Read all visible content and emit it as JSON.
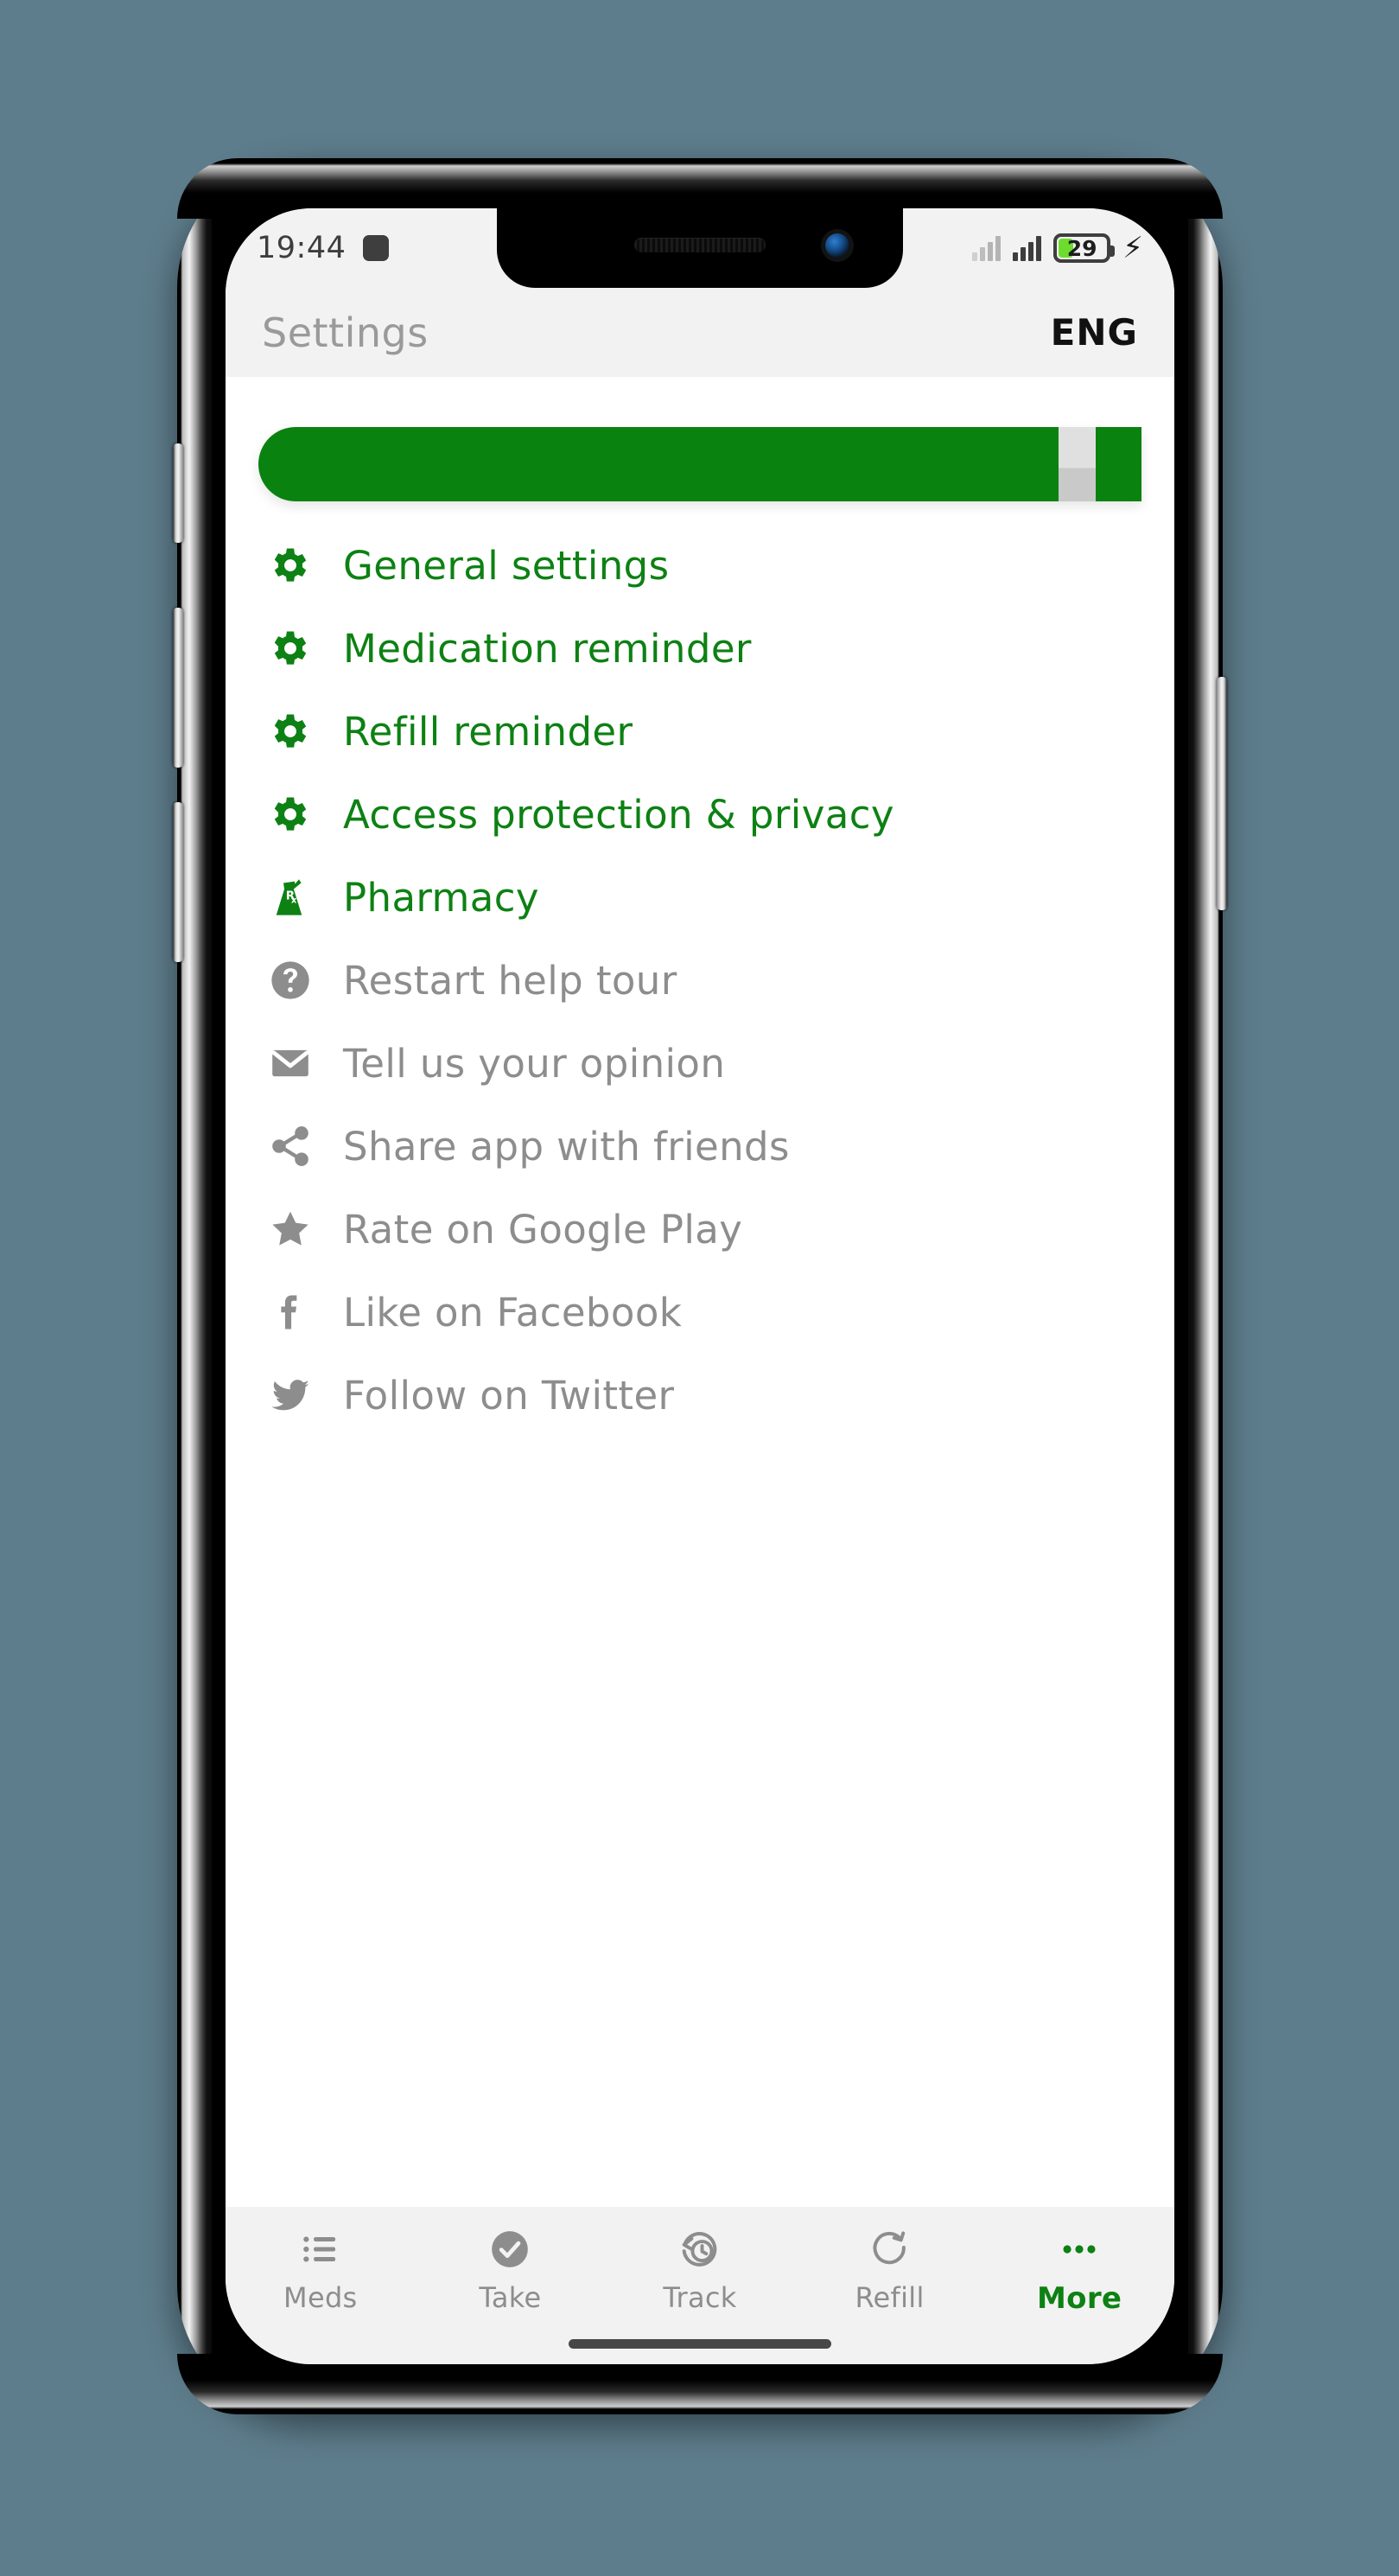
{
  "theme": {
    "background": "#5e7d8c",
    "accent_green": "#0d8113",
    "banner_green": "#0a8210",
    "muted_gray": "#8d8d8d",
    "header_bg": "#f2f2f2"
  },
  "status_bar": {
    "time": "19:44",
    "notification_icon": "square-notification-icon",
    "signal_icons": [
      "signal-bars-dim-icon",
      "signal-bars-icon"
    ],
    "battery_level": "29",
    "battery_percent": 29,
    "charging_icon": "charging-bolt-icon"
  },
  "header": {
    "title": "Settings",
    "language": "ENG"
  },
  "banner": {
    "name": "progress-banner",
    "color": "#0a8210"
  },
  "menu": {
    "items": [
      {
        "label": "General settings",
        "icon": "gear-icon",
        "style": "green"
      },
      {
        "label": "Medication reminder",
        "icon": "gear-icon",
        "style": "green"
      },
      {
        "label": "Refill reminder",
        "icon": "gear-icon",
        "style": "green"
      },
      {
        "label": "Access protection & privacy",
        "icon": "gear-icon",
        "style": "green"
      },
      {
        "label": "Pharmacy",
        "icon": "pharmacy-rx-icon",
        "style": "green"
      },
      {
        "label": "Restart help tour",
        "icon": "help-circle-icon",
        "style": "gray"
      },
      {
        "label": "Tell us your opinion",
        "icon": "envelope-icon",
        "style": "gray"
      },
      {
        "label": "Share app with friends",
        "icon": "share-icon",
        "style": "gray"
      },
      {
        "label": "Rate on Google Play",
        "icon": "star-icon",
        "style": "gray"
      },
      {
        "label": "Like on Facebook",
        "icon": "facebook-icon",
        "style": "gray"
      },
      {
        "label": "Follow on Twitter",
        "icon": "twitter-icon",
        "style": "gray"
      }
    ]
  },
  "bottom_nav": {
    "items": [
      {
        "label": "Meds",
        "icon": "list-icon",
        "active": false
      },
      {
        "label": "Take",
        "icon": "check-circle-icon",
        "active": false
      },
      {
        "label": "Track",
        "icon": "history-clock-icon",
        "active": false
      },
      {
        "label": "Refill",
        "icon": "refresh-icon",
        "active": false
      },
      {
        "label": "More",
        "icon": "ellipsis-icon",
        "active": true
      }
    ]
  }
}
